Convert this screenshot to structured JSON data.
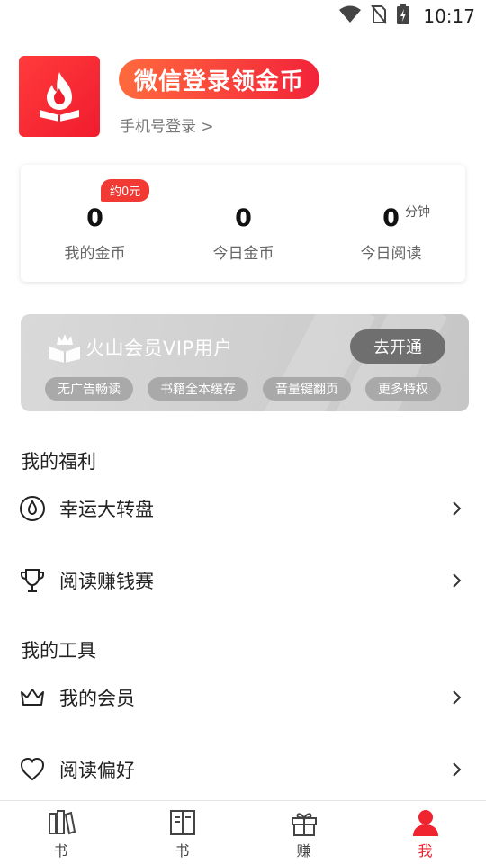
{
  "status_bar": {
    "time": "10:17",
    "icons": [
      "wifi-icon",
      "no-sim-icon",
      "battery-charging-icon"
    ]
  },
  "profile": {
    "login_label": "微信登录领金币",
    "phone_login_label": "手机号登录 >"
  },
  "stats": {
    "badge": "约0元",
    "items": [
      {
        "value": "0",
        "label": "我的金币"
      },
      {
        "value": "0",
        "label": "今日金币"
      },
      {
        "value": "0",
        "label": "今日阅读",
        "unit": "分钟"
      }
    ]
  },
  "vip": {
    "title": "火山会员VIP用户",
    "cta": "去开通",
    "features": [
      "无广告畅读",
      "书籍全本缓存",
      "音量键翻页",
      "更多特权"
    ]
  },
  "sections": {
    "welfare_title": "我的福利",
    "tools_title": "我的工具"
  },
  "menu": {
    "welfare": [
      {
        "label": "幸运大转盘",
        "icon": "drop-circle-icon"
      },
      {
        "label": "阅读赚钱赛",
        "icon": "trophy-icon"
      }
    ],
    "tools": [
      {
        "label": "我的会员",
        "icon": "crown-icon"
      },
      {
        "label": "阅读偏好",
        "icon": "heart-icon"
      }
    ]
  },
  "tab_bar": {
    "tabs": [
      {
        "label": "书",
        "icon": "bookshelf-icon"
      },
      {
        "label": "书",
        "icon": "open-book-icon"
      },
      {
        "label": "赚",
        "icon": "gift-icon"
      },
      {
        "label": "我",
        "icon": "user-icon",
        "active": true
      }
    ]
  },
  "colors": {
    "accent": "#f0242f",
    "login_gradient_start": "#ff6a3d",
    "login_gradient_end": "#f2233a",
    "vip_bg": "#d3d3d3"
  }
}
